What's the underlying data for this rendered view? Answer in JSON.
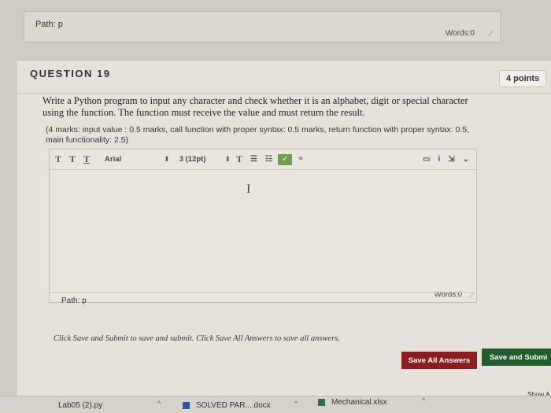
{
  "previous_editor": {
    "path_label": "Path: p",
    "words_label": "Words:0"
  },
  "question": {
    "title": "QUESTION 19",
    "points": "4 points",
    "text": "Write a Python program to input any character and check whether it is an alphabet, digit or special character using the function. The function must receive the value and must return the result.",
    "marks": "(4 marks: input value : 0.5 marks, call function with proper syntax: 0.5 marks, return function with proper syntax: 0.5, main functionality: 2.5)"
  },
  "editor": {
    "toolbar": {
      "t1": "T",
      "t2": "T",
      "t3": "T",
      "font": "Arial",
      "size": "3 (12pt)",
      "format_t": "T",
      "list_icons": [
        "bullet-list-icon",
        "numbered-list-icon"
      ],
      "right_icons": [
        "preview-icon",
        "spellcheck-icon",
        "expand-icon"
      ]
    },
    "path_label": "Path: p",
    "words_label": "Words:0"
  },
  "instructions": "Click Save and Submit to save and submit. Click Save All Answers to save all answers.",
  "buttons": {
    "save_all": "Save All Answers",
    "save_submit": "Save and Submi"
  },
  "downloads": {
    "items": [
      {
        "label": "Lab05 (2).py"
      },
      {
        "label": "SOLVED PAR....docx"
      },
      {
        "label": "Mechanical.xlsx"
      }
    ],
    "show_all": "Show A"
  },
  "colors": {
    "save_all_bg": "#8b1d1d",
    "save_submit_bg": "#1f5d2a"
  }
}
